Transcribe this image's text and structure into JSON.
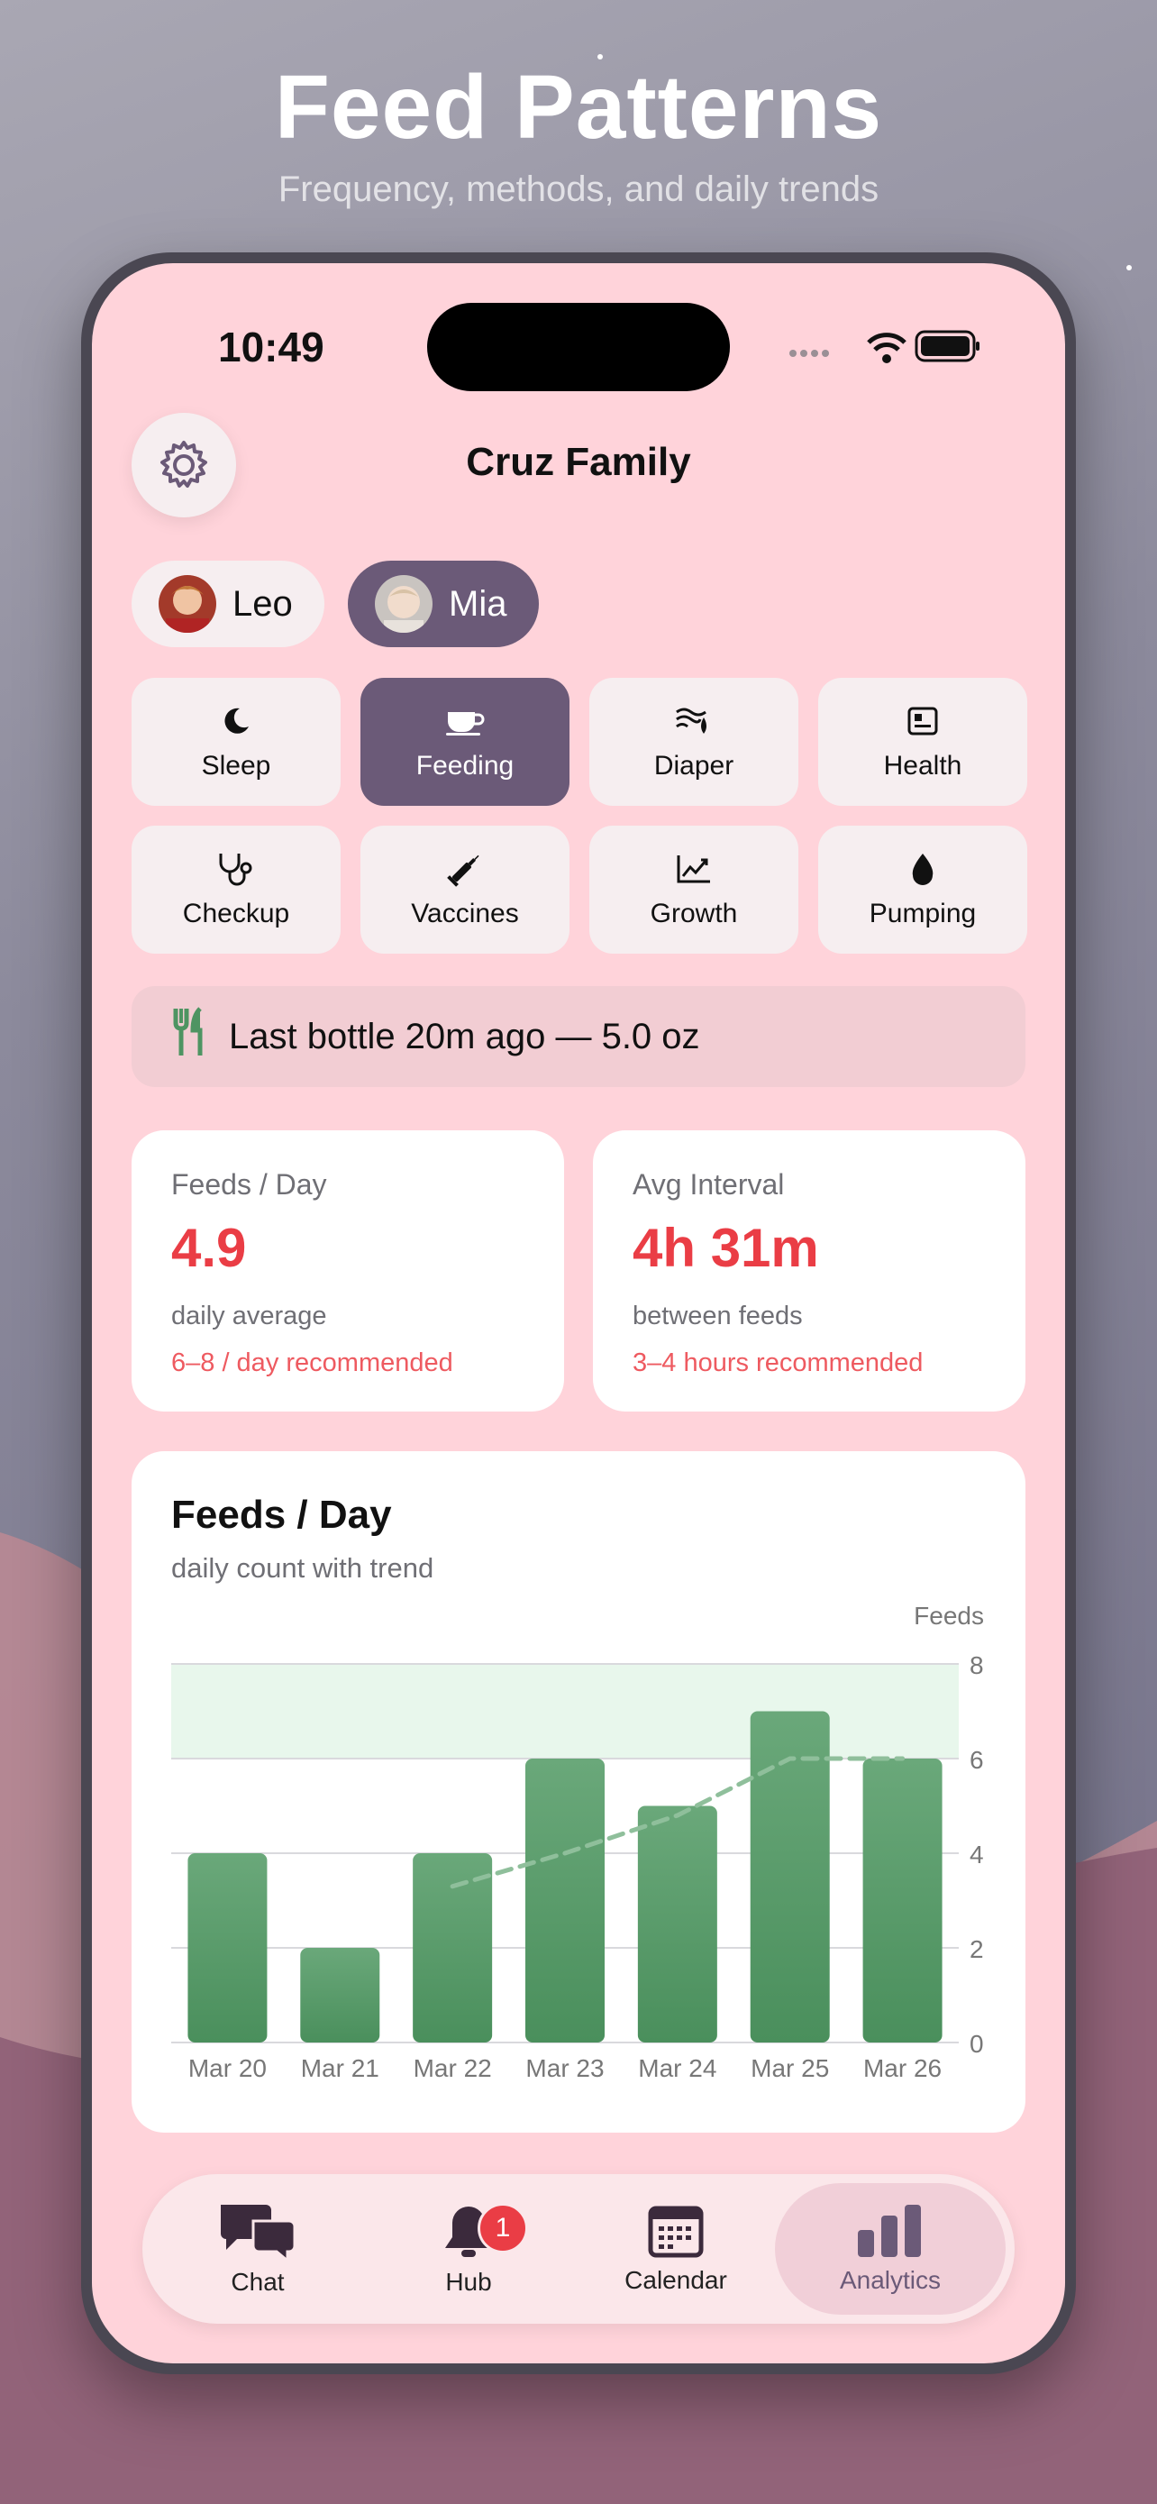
{
  "headline": {
    "title": "Feed Patterns",
    "subtitle": "Frequency, methods, and daily trends"
  },
  "status": {
    "time": "10:49"
  },
  "header": {
    "title": "Cruz Family"
  },
  "children": [
    {
      "name": "Leo",
      "selected": false
    },
    {
      "name": "Mia",
      "selected": true
    }
  ],
  "categories": [
    {
      "label": "Sleep",
      "icon": "moon-icon"
    },
    {
      "label": "Feeding",
      "icon": "cup-icon",
      "active": true
    },
    {
      "label": "Diaper",
      "icon": "diaper-icon"
    },
    {
      "label": "Health",
      "icon": "health-card-icon"
    },
    {
      "label": "Checkup",
      "icon": "stethoscope-icon"
    },
    {
      "label": "Vaccines",
      "icon": "syringe-icon"
    },
    {
      "label": "Growth",
      "icon": "growth-chart-icon"
    },
    {
      "label": "Pumping",
      "icon": "drop-icon"
    }
  ],
  "banner": {
    "text": "Last bottle 20m ago — 5.0 oz",
    "icon": "fork-knife-icon"
  },
  "stats": [
    {
      "title": "Feeds / Day",
      "value": "4.9",
      "sub": "daily average",
      "rec": "6–8 / day recommended"
    },
    {
      "title": "Avg Interval",
      "value": "4h 31m",
      "sub": "between feeds",
      "rec": "3–4 hours recommended"
    }
  ],
  "chart": {
    "title": "Feeds / Day",
    "subtitle": "daily count with trend"
  },
  "chart_data": {
    "type": "bar",
    "categories": [
      "Mar 20",
      "Mar 21",
      "Mar 22",
      "Mar 23",
      "Mar 24",
      "Mar 25",
      "Mar 26"
    ],
    "values": [
      4,
      2,
      4,
      6,
      5,
      7,
      6
    ],
    "trend": {
      "x_start": "Mar 22",
      "values": [
        3.3,
        4.0,
        4.8,
        6.0,
        6.0
      ]
    },
    "recommended_band": [
      6,
      8
    ],
    "ylabel": "Feeds",
    "ylim": [
      0,
      8
    ],
    "yticks": [
      0,
      2,
      4,
      6,
      8
    ],
    "y_axis_side": "right",
    "grid": true,
    "colors": {
      "bar": "#4e9462",
      "trend": "#8fbf9b",
      "band": "#e8f7ec"
    }
  },
  "tabs": [
    {
      "label": "Chat",
      "icon": "chat-icon"
    },
    {
      "label": "Hub",
      "icon": "bell-icon",
      "badge": "1"
    },
    {
      "label": "Calendar",
      "icon": "calendar-icon"
    },
    {
      "label": "Analytics",
      "icon": "bar-chart-icon",
      "active": true
    }
  ],
  "colors": {
    "accent": "#6b5a78",
    "alert": "#ea3d45",
    "screen_bg": "#ffd3da"
  }
}
